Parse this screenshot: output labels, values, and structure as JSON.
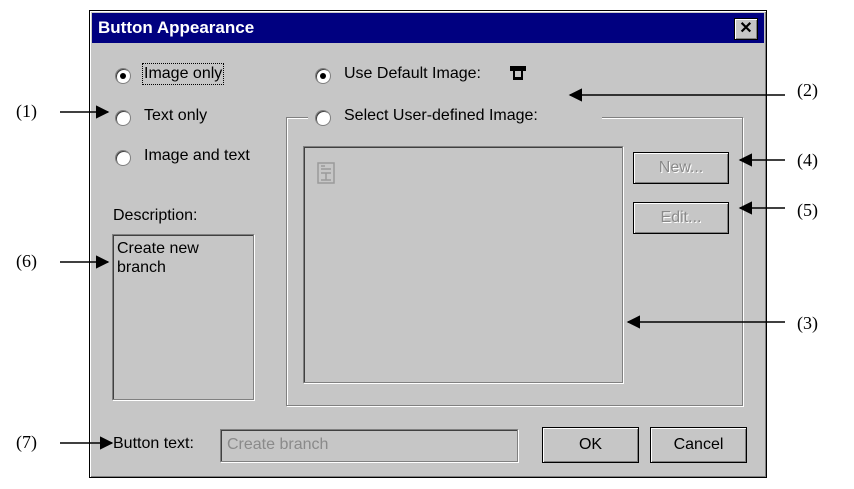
{
  "dialog": {
    "title": "Button Appearance",
    "close_glyph": "✕",
    "display_options": [
      {
        "label": "Image only",
        "selected": true
      },
      {
        "label": "Text only",
        "selected": false
      },
      {
        "label": "Image and text",
        "selected": false
      }
    ],
    "image_options": [
      {
        "label": "Use Default Image:",
        "selected": true
      },
      {
        "label": "Select User-defined Image:",
        "selected": false
      }
    ],
    "description_label": "Description:",
    "description_text": "Create new\nbranch",
    "new_button": "New...",
    "edit_button": "Edit...",
    "button_text_label": "Button text:",
    "button_text_value": "Create branch",
    "ok_button": "OK",
    "cancel_button": "Cancel"
  },
  "callouts": [
    "(1)",
    "(2)",
    "(3)",
    "(4)",
    "(5)",
    "(6)",
    "(7)"
  ]
}
